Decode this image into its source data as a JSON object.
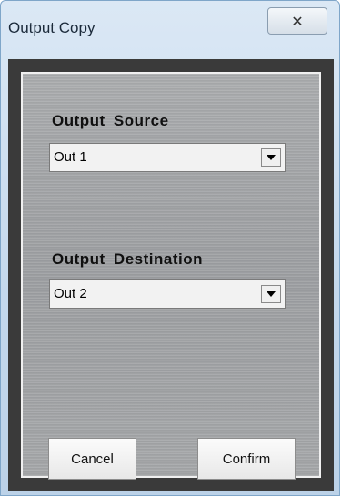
{
  "window": {
    "title": "Output Copy",
    "close_glyph": "✕"
  },
  "source": {
    "label": "Output  Source",
    "value": "Out 1"
  },
  "destination": {
    "label": "Output  Destination",
    "value": "Out 2"
  },
  "buttons": {
    "cancel": "Cancel",
    "confirm": "Confirm"
  }
}
